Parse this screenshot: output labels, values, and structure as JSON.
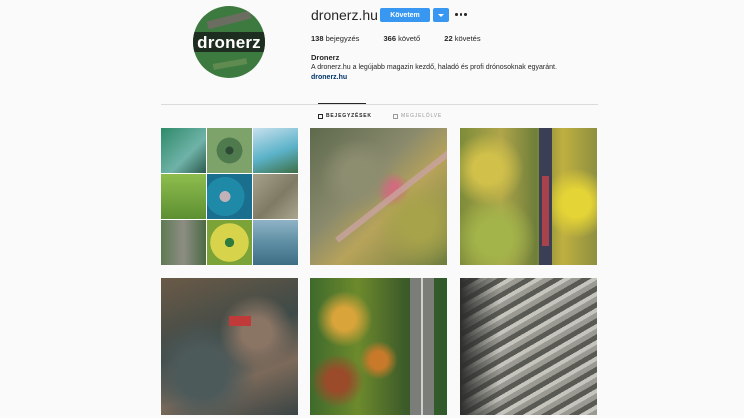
{
  "profile": {
    "avatar_text": "dronerz",
    "username": "dronerz.hu",
    "follow_label": "Követem",
    "stats": {
      "posts_count": "138",
      "posts_label": "bejegyzés",
      "followers_count": "366",
      "followers_label": "követő",
      "following_count": "22",
      "following_label": "követés"
    },
    "name": "Dronerz",
    "bio": "A dronerz.hu a legújabb magazin kezdő, haladó és profi drónosoknak egyaránt.",
    "link": "dronerz.hu"
  },
  "tabs": [
    {
      "label": "BEJEGYZÉSEK",
      "active": true,
      "icon": "grid-icon"
    },
    {
      "label": "MEGJELÖLVE",
      "active": false,
      "icon": "tag-icon"
    }
  ],
  "posts": [
    {
      "icon": "collage-photo"
    },
    {
      "icon": "forest-photo"
    },
    {
      "icon": "railway-photo"
    },
    {
      "icon": "quarry-photo"
    },
    {
      "icon": "road-forest-photo"
    },
    {
      "icon": "mine-photo"
    }
  ],
  "colors": {
    "accent": "#3897f0",
    "link": "#003569",
    "background": "#fafafa"
  }
}
